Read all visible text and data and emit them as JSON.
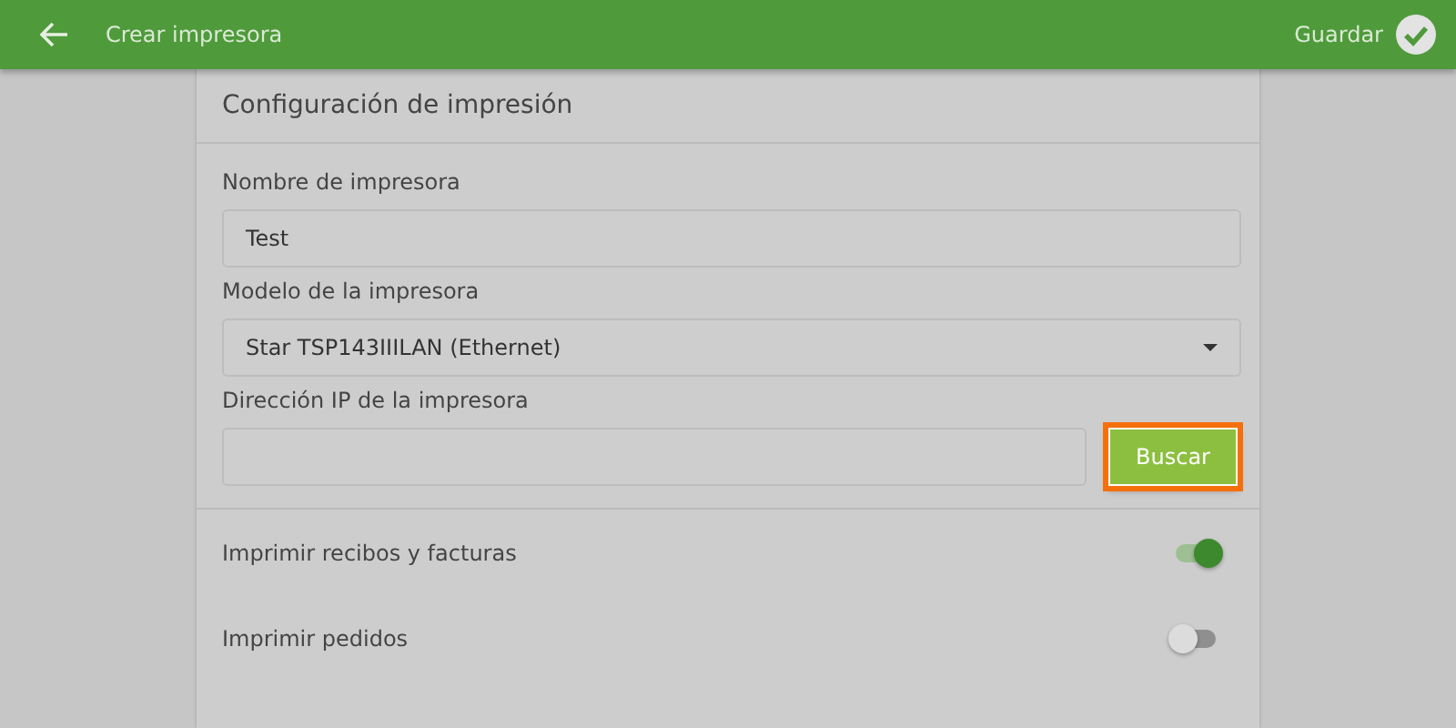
{
  "top_bar": {
    "title": "Crear impresora",
    "save_label": "Guardar"
  },
  "card": {
    "title": "Configuración de impresión",
    "fields": [
      {
        "kind": "text",
        "label": "Nombre de impresora",
        "value": "Test"
      },
      {
        "kind": "select",
        "label": "Modelo de la impresora",
        "value": "Star TSP143IIILAN (Ethernet)"
      },
      {
        "kind": "search",
        "label": "Dirección IP de la impresora",
        "button": "Buscar"
      }
    ],
    "toggles": [
      {
        "label": "Imprimir recibos y facturas",
        "on": true
      },
      {
        "label": "Imprimir pedidos",
        "on": false
      }
    ]
  }
}
